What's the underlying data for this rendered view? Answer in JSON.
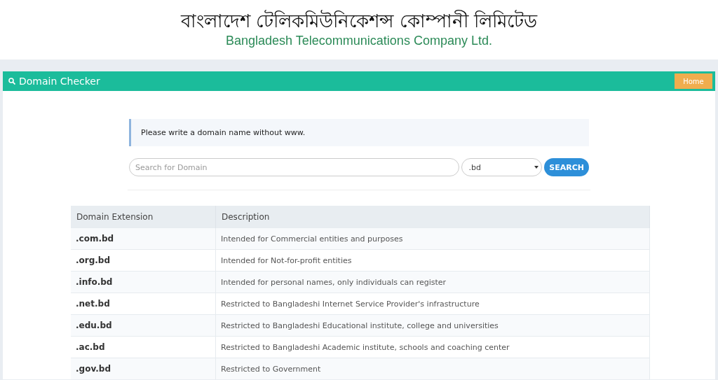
{
  "header": {
    "title_bengali": "বাংলাদেশ টেলিকমিউনিকেশন্স কোম্পানী লিমিটেড",
    "title_english": "Bangladesh Telecommunications Company Ltd."
  },
  "toolbar": {
    "title": "Domain Checker",
    "button": "Home"
  },
  "alert": {
    "text": "Please write a domain name without www."
  },
  "search": {
    "placeholder": "Search for Domain",
    "extension": ".bd",
    "button": "SEARCH"
  },
  "table": {
    "columns": [
      "Domain Extension",
      "Description"
    ],
    "rows": [
      {
        "extension": ".com.bd",
        "description": "Intended for Commercial entities and purposes"
      },
      {
        "extension": ".org.bd",
        "description": "Intended for Not-for-profit entities"
      },
      {
        "extension": ".info.bd",
        "description": "Intended for personal names, only individuals can register"
      },
      {
        "extension": ".net.bd",
        "description": "Restricted to Bangladeshi Internet Service Provider's infrastructure"
      },
      {
        "extension": ".edu.bd",
        "description": "Restricted to Bangladeshi Educational institute, college and universities"
      },
      {
        "extension": ".ac.bd",
        "description": "Restricted to Bangladeshi Academic institute, schools and coaching center"
      },
      {
        "extension": ".gov.bd",
        "description": "Restricted to Government"
      }
    ]
  }
}
